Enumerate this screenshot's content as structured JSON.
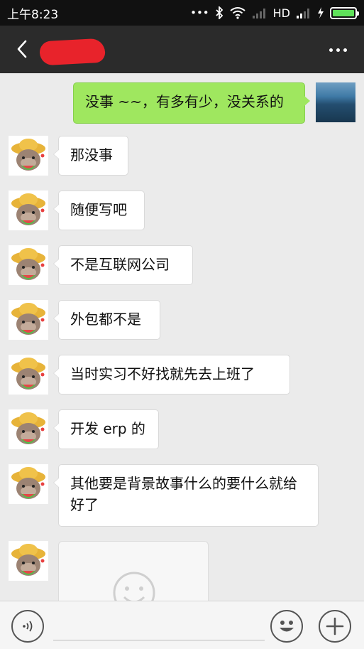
{
  "status_bar": {
    "time": "上午8:23",
    "network": "HD",
    "indicators": [
      "more-dots-icon",
      "bluetooth-icon",
      "wifi-icon",
      "signal-icon",
      "charging-icon",
      "battery-icon"
    ]
  },
  "nav": {
    "back_icon": "chevron-left-icon",
    "contact_name_redacted": true,
    "more_icon": "more-horizontal-icon"
  },
  "messages": [
    {
      "side": "right",
      "text": "没事 ~~，有多有少，没关系的"
    },
    {
      "side": "left",
      "text": "那没事"
    },
    {
      "side": "left",
      "text": "随便写吧"
    },
    {
      "side": "left",
      "text": "不是互联网公司"
    },
    {
      "side": "left",
      "text": "外包都不是"
    },
    {
      "side": "left",
      "text": "当时实习不好找就先去上班了"
    },
    {
      "side": "left",
      "text": "开发 erp 的"
    },
    {
      "side": "left",
      "text": "其他要是背景故事什么的要什么就给好了"
    },
    {
      "side": "left",
      "type": "sticker",
      "sticker": "smiley-sticker"
    }
  ],
  "input_bar": {
    "voice_icon": "voice-icon",
    "emoji_icon": "emoji-icon",
    "plus_icon": "plus-icon"
  },
  "colors": {
    "outgoing_bubble": "#9fe75f",
    "incoming_bubble": "#ffffff",
    "chat_background": "#ebebeb",
    "nav_background": "#2b2b2b"
  }
}
